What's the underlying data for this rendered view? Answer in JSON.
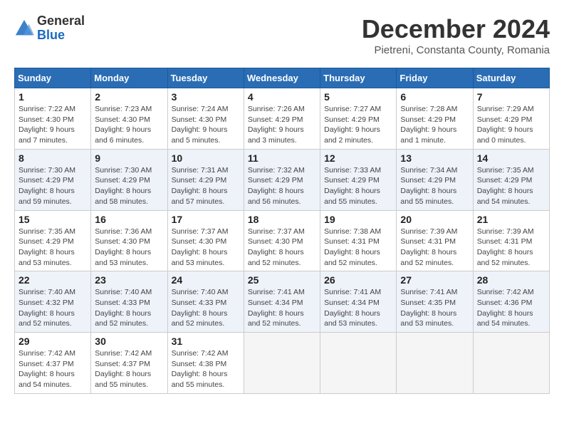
{
  "logo": {
    "general": "General",
    "blue": "Blue"
  },
  "title": "December 2024",
  "subtitle": "Pietreni, Constanta County, Romania",
  "days_header": [
    "Sunday",
    "Monday",
    "Tuesday",
    "Wednesday",
    "Thursday",
    "Friday",
    "Saturday"
  ],
  "weeks": [
    [
      {
        "day": "1",
        "sunrise": "7:22 AM",
        "sunset": "4:30 PM",
        "daylight": "9 hours and 7 minutes."
      },
      {
        "day": "2",
        "sunrise": "7:23 AM",
        "sunset": "4:30 PM",
        "daylight": "9 hours and 6 minutes."
      },
      {
        "day": "3",
        "sunrise": "7:24 AM",
        "sunset": "4:30 PM",
        "daylight": "9 hours and 5 minutes."
      },
      {
        "day": "4",
        "sunrise": "7:26 AM",
        "sunset": "4:29 PM",
        "daylight": "9 hours and 3 minutes."
      },
      {
        "day": "5",
        "sunrise": "7:27 AM",
        "sunset": "4:29 PM",
        "daylight": "9 hours and 2 minutes."
      },
      {
        "day": "6",
        "sunrise": "7:28 AM",
        "sunset": "4:29 PM",
        "daylight": "9 hours and 1 minute."
      },
      {
        "day": "7",
        "sunrise": "7:29 AM",
        "sunset": "4:29 PM",
        "daylight": "9 hours and 0 minutes."
      }
    ],
    [
      {
        "day": "8",
        "sunrise": "7:30 AM",
        "sunset": "4:29 PM",
        "daylight": "8 hours and 59 minutes."
      },
      {
        "day": "9",
        "sunrise": "7:30 AM",
        "sunset": "4:29 PM",
        "daylight": "8 hours and 58 minutes."
      },
      {
        "day": "10",
        "sunrise": "7:31 AM",
        "sunset": "4:29 PM",
        "daylight": "8 hours and 57 minutes."
      },
      {
        "day": "11",
        "sunrise": "7:32 AM",
        "sunset": "4:29 PM",
        "daylight": "8 hours and 56 minutes."
      },
      {
        "day": "12",
        "sunrise": "7:33 AM",
        "sunset": "4:29 PM",
        "daylight": "8 hours and 55 minutes."
      },
      {
        "day": "13",
        "sunrise": "7:34 AM",
        "sunset": "4:29 PM",
        "daylight": "8 hours and 55 minutes."
      },
      {
        "day": "14",
        "sunrise": "7:35 AM",
        "sunset": "4:29 PM",
        "daylight": "8 hours and 54 minutes."
      }
    ],
    [
      {
        "day": "15",
        "sunrise": "7:35 AM",
        "sunset": "4:29 PM",
        "daylight": "8 hours and 53 minutes."
      },
      {
        "day": "16",
        "sunrise": "7:36 AM",
        "sunset": "4:30 PM",
        "daylight": "8 hours and 53 minutes."
      },
      {
        "day": "17",
        "sunrise": "7:37 AM",
        "sunset": "4:30 PM",
        "daylight": "8 hours and 53 minutes."
      },
      {
        "day": "18",
        "sunrise": "7:37 AM",
        "sunset": "4:30 PM",
        "daylight": "8 hours and 52 minutes."
      },
      {
        "day": "19",
        "sunrise": "7:38 AM",
        "sunset": "4:31 PM",
        "daylight": "8 hours and 52 minutes."
      },
      {
        "day": "20",
        "sunrise": "7:39 AM",
        "sunset": "4:31 PM",
        "daylight": "8 hours and 52 minutes."
      },
      {
        "day": "21",
        "sunrise": "7:39 AM",
        "sunset": "4:31 PM",
        "daylight": "8 hours and 52 minutes."
      }
    ],
    [
      {
        "day": "22",
        "sunrise": "7:40 AM",
        "sunset": "4:32 PM",
        "daylight": "8 hours and 52 minutes."
      },
      {
        "day": "23",
        "sunrise": "7:40 AM",
        "sunset": "4:33 PM",
        "daylight": "8 hours and 52 minutes."
      },
      {
        "day": "24",
        "sunrise": "7:40 AM",
        "sunset": "4:33 PM",
        "daylight": "8 hours and 52 minutes."
      },
      {
        "day": "25",
        "sunrise": "7:41 AM",
        "sunset": "4:34 PM",
        "daylight": "8 hours and 52 minutes."
      },
      {
        "day": "26",
        "sunrise": "7:41 AM",
        "sunset": "4:34 PM",
        "daylight": "8 hours and 53 minutes."
      },
      {
        "day": "27",
        "sunrise": "7:41 AM",
        "sunset": "4:35 PM",
        "daylight": "8 hours and 53 minutes."
      },
      {
        "day": "28",
        "sunrise": "7:42 AM",
        "sunset": "4:36 PM",
        "daylight": "8 hours and 54 minutes."
      }
    ],
    [
      {
        "day": "29",
        "sunrise": "7:42 AM",
        "sunset": "4:37 PM",
        "daylight": "8 hours and 54 minutes."
      },
      {
        "day": "30",
        "sunrise": "7:42 AM",
        "sunset": "4:37 PM",
        "daylight": "8 hours and 55 minutes."
      },
      {
        "day": "31",
        "sunrise": "7:42 AM",
        "sunset": "4:38 PM",
        "daylight": "8 hours and 55 minutes."
      },
      null,
      null,
      null,
      null
    ]
  ]
}
